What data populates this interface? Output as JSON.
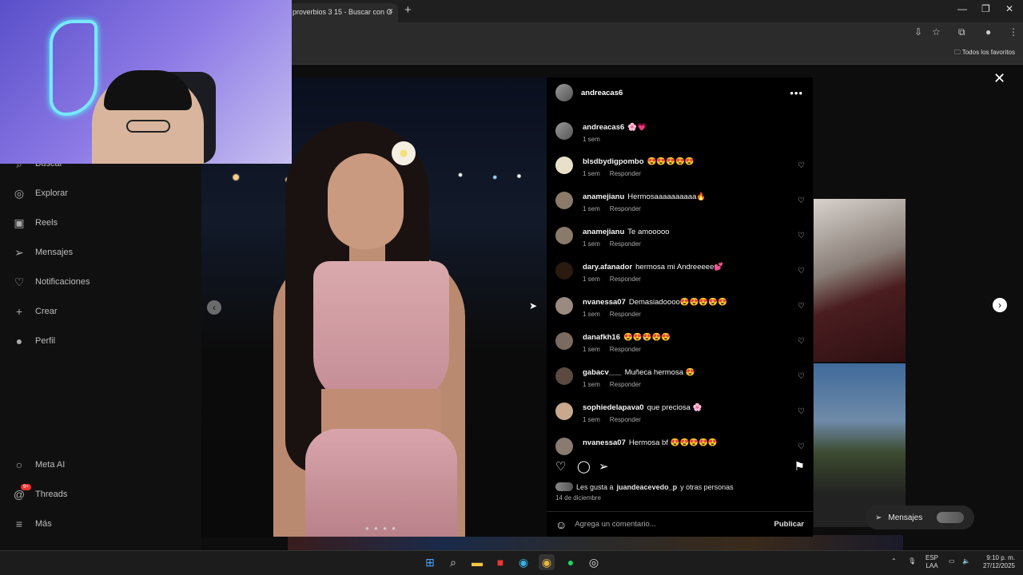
{
  "browser": {
    "tab_title": "proverbios 3 15 - Buscar con G",
    "new_tab": "+",
    "bookmarks_folder": "Todos los favoritos"
  },
  "sidebar": {
    "items": [
      {
        "label": "Buscar",
        "icon": "search-icon"
      },
      {
        "label": "Explorar",
        "icon": "compass-icon"
      },
      {
        "label": "Reels",
        "icon": "reels-icon"
      },
      {
        "label": "Mensajes",
        "icon": "send-icon"
      },
      {
        "label": "Notificaciones",
        "icon": "heart-icon"
      },
      {
        "label": "Crear",
        "icon": "plus-icon"
      },
      {
        "label": "Perfil",
        "icon": "avatar-icon"
      }
    ],
    "bottom": [
      {
        "label": "Meta AI",
        "icon": "meta-ai-icon"
      },
      {
        "label": "Threads",
        "icon": "threads-icon",
        "badge": "9+"
      },
      {
        "label": "Más",
        "icon": "menu-icon"
      }
    ]
  },
  "post": {
    "author": "andreacas6",
    "caption_user": "andreacas6",
    "caption_text": "🌸💗",
    "caption_time": "1 sem",
    "comments": [
      {
        "user": "blsdbydigpombo",
        "text": "😍😍😍😍😍",
        "time": "1 sem",
        "reply": "Responder"
      },
      {
        "user": "anamejianu",
        "text": "Hermosaaaaaaaaaa🔥",
        "time": "1 sem",
        "reply": "Responder"
      },
      {
        "user": "anamejianu",
        "text": "Te amooooo",
        "time": "1 sem",
        "reply": "Responder"
      },
      {
        "user": "dary.afanador",
        "text": "hermosa mi Andreeeee💕",
        "time": "1 sem",
        "reply": "Responder"
      },
      {
        "user": "nvanessa07",
        "text": "Demasiadoooo😍😍😍😍😍",
        "time": "1 sem",
        "reply": "Responder"
      },
      {
        "user": "danafkh16",
        "text": "😍😍😍😍😍",
        "time": "1 sem",
        "reply": "Responder"
      },
      {
        "user": "gabacv___",
        "text": "Muñeca hermosa 😍",
        "time": "1 sem",
        "reply": "Responder"
      },
      {
        "user": "sophiedelapava0",
        "text": "que preciosa 🌸",
        "time": "1 sem",
        "reply": "Responder"
      },
      {
        "user": "nvanessa07",
        "text": "Hermosa bf 😍😍😍😍😍",
        "time": "",
        "reply": ""
      }
    ],
    "likes_prefix": "Les gusta a",
    "likes_user": "juandeacevedo_p",
    "likes_suffix": "y otras personas",
    "date": "14 de diciembre",
    "comment_placeholder": "Agrega un comentario...",
    "publish": "Publicar"
  },
  "messages_button": "Mensajes",
  "taskbar": {
    "lang_top": "ESP",
    "lang_bottom": "LAA",
    "time": "9:10 p. m.",
    "date": "27/12/2025"
  }
}
